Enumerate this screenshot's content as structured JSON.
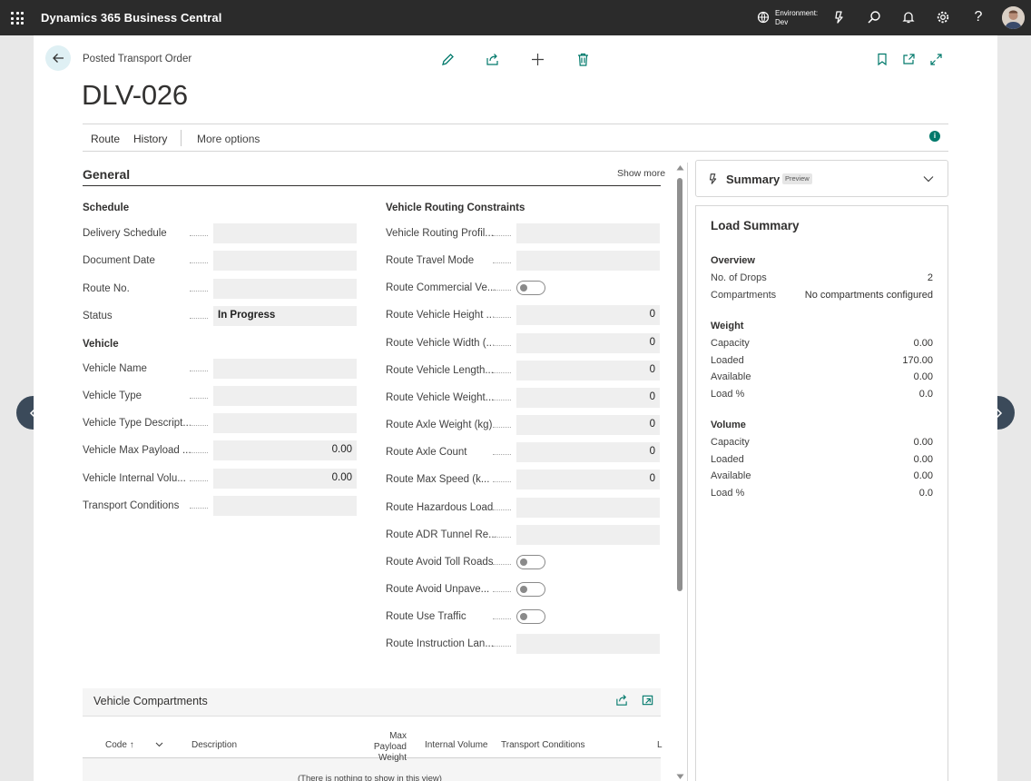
{
  "app": {
    "title": "Dynamics 365 Business Central"
  },
  "environment": {
    "label_line1": "Environment:",
    "label_line2": "Dev"
  },
  "header": {
    "caption": "Posted Transport Order",
    "title": "DLV-026"
  },
  "actions": {
    "route": "Route",
    "history": "History",
    "more": "More options",
    "info": "i"
  },
  "general": {
    "title": "General",
    "show_more": "Show more",
    "schedule": {
      "title": "Schedule",
      "fields": [
        {
          "label": "Delivery Schedule",
          "value": ""
        },
        {
          "label": "Document Date",
          "value": ""
        },
        {
          "label": "Route No.",
          "value": ""
        },
        {
          "label": "Status",
          "value": "In Progress"
        }
      ]
    },
    "vehicle": {
      "title": "Vehicle",
      "fields": [
        {
          "label": "Vehicle Name",
          "value": ""
        },
        {
          "label": "Vehicle Type",
          "value": ""
        },
        {
          "label": "Vehicle Type Descript...",
          "value": ""
        },
        {
          "label": "Vehicle Max Payload ...",
          "value": "0.00"
        },
        {
          "label": "Vehicle Internal Volu...",
          "value": "0.00"
        },
        {
          "label": "Transport Conditions",
          "value": ""
        }
      ]
    },
    "routing": {
      "title": "Vehicle Routing Constraints",
      "fields": [
        {
          "label": "Vehicle Routing Profil...",
          "value": ""
        },
        {
          "label": "Route Travel Mode",
          "value": ""
        },
        {
          "label": "Route Commercial Ve...",
          "value": "",
          "toggle": true
        },
        {
          "label": "Route Vehicle Height ...",
          "value": "0"
        },
        {
          "label": "Route Vehicle Width (...",
          "value": "0"
        },
        {
          "label": "Route Vehicle Length...",
          "value": "0"
        },
        {
          "label": "Route Vehicle Weight...",
          "value": "0"
        },
        {
          "label": "Route Axle Weight (kg)",
          "value": "0"
        },
        {
          "label": "Route Axle Count",
          "value": "0"
        },
        {
          "label": "Route Max Speed (k...",
          "value": "0"
        },
        {
          "label": "Route Hazardous Load",
          "value": ""
        },
        {
          "label": "Route ADR Tunnel Re...",
          "value": ""
        },
        {
          "label": "Route Avoid Toll Roads",
          "value": "",
          "toggle": true
        },
        {
          "label": "Route Avoid Unpave...",
          "value": "",
          "toggle": true
        },
        {
          "label": "Route Use Traffic",
          "value": "",
          "toggle": true
        },
        {
          "label": "Route Instruction Lan...",
          "value": ""
        }
      ]
    }
  },
  "compartments": {
    "title": "Vehicle Compartments",
    "columns": [
      "Code",
      "Description",
      "Max Payload",
      "Weight",
      "Internal Volume",
      "Transport Conditions",
      "L"
    ],
    "sort_indicator": "↑",
    "empty": "(There is nothing to show in this view)"
  },
  "summary": {
    "title": "Summary",
    "badge": "Preview"
  },
  "load_summary": {
    "title": "Load Summary",
    "overview": {
      "title": "Overview",
      "rows": [
        {
          "label": "No. of Drops",
          "value": "2"
        },
        {
          "label": "Compartments",
          "value": "No compartments configured"
        }
      ]
    },
    "weight": {
      "title": "Weight",
      "rows": [
        {
          "label": "Capacity",
          "value": "0.00"
        },
        {
          "label": "Loaded",
          "value": "170.00"
        },
        {
          "label": "Available",
          "value": "0.00"
        },
        {
          "label": "Load %",
          "value": "0.0"
        }
      ]
    },
    "volume": {
      "title": "Volume",
      "rows": [
        {
          "label": "Capacity",
          "value": "0.00"
        },
        {
          "label": "Loaded",
          "value": "0.00"
        },
        {
          "label": "Available",
          "value": "0.00"
        },
        {
          "label": "Load %",
          "value": "0.0"
        }
      ]
    }
  },
  "colors": {
    "topbar": "#2b2b2b",
    "accent": "#00796b",
    "field_bg": "#efefef"
  }
}
